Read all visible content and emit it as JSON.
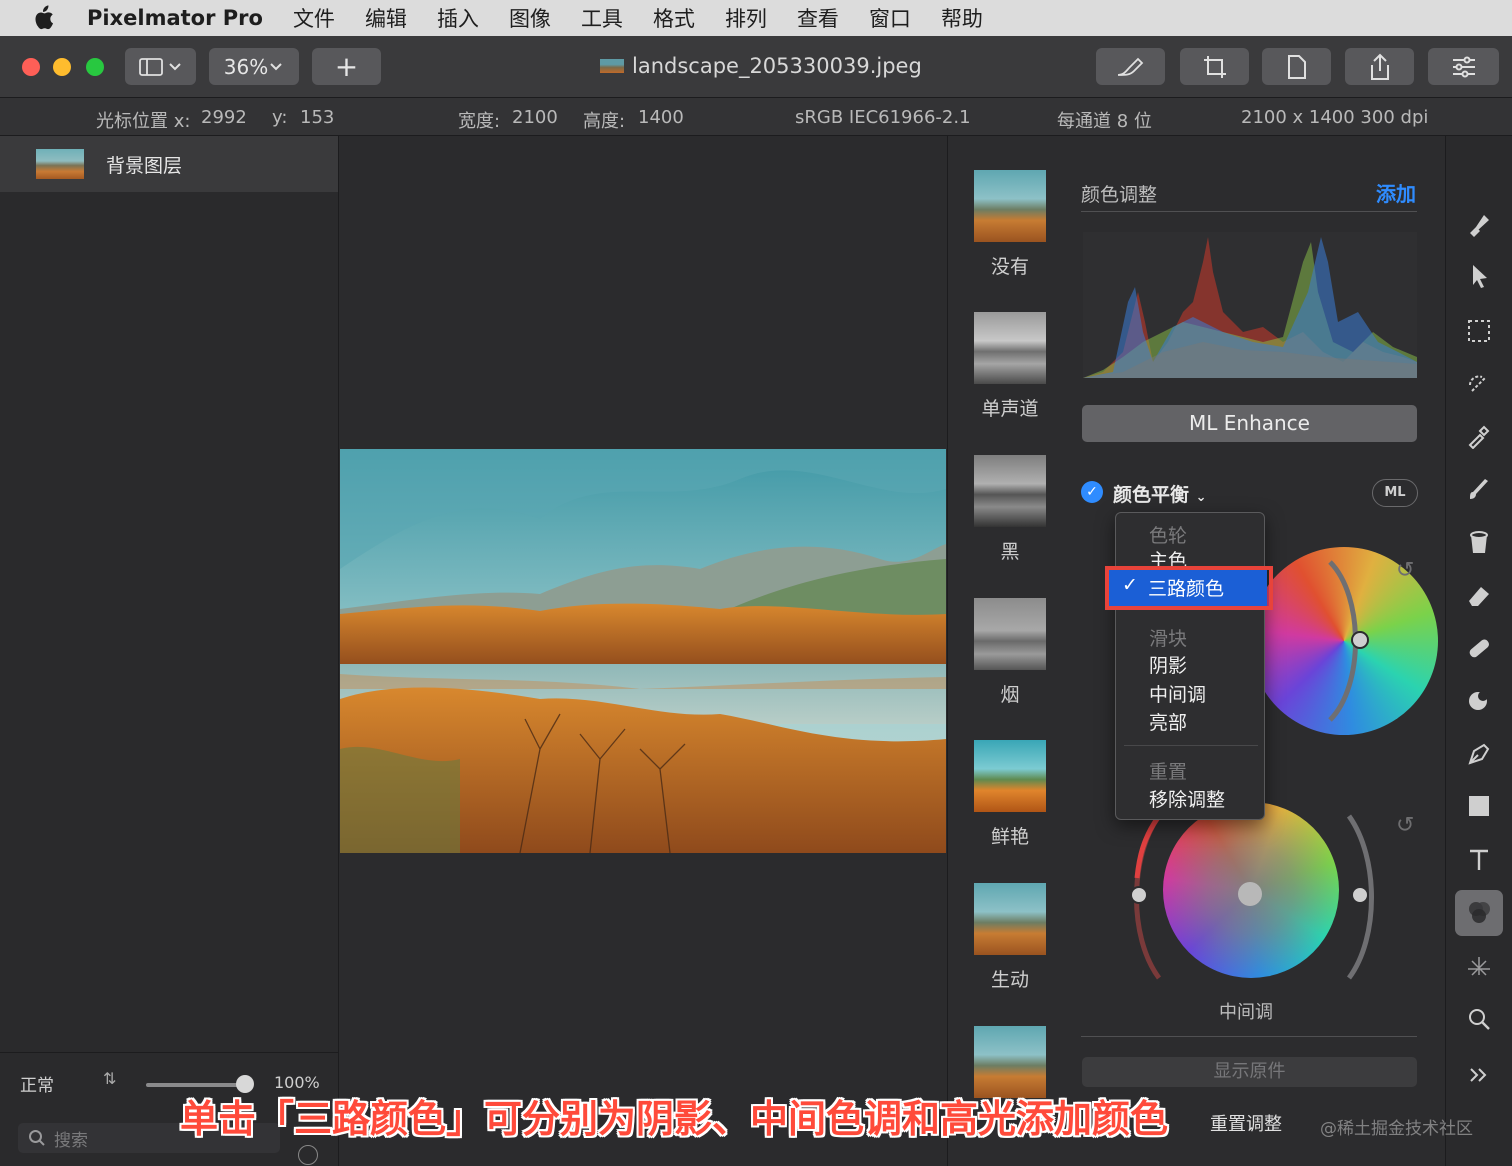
{
  "menubar": {
    "app_name": "Pixelmator Pro",
    "items": [
      "文件",
      "编辑",
      "插入",
      "图像",
      "工具",
      "格式",
      "排列",
      "查看",
      "窗口",
      "帮助"
    ]
  },
  "toolbar": {
    "zoom": "36%",
    "add_label": "+",
    "document_title": "landscape_205330039.jpeg"
  },
  "infobar": {
    "cursor_label": "光标位置 x:",
    "cursor_x": "2992",
    "cursor_y_label": "y:",
    "cursor_y": "153",
    "width_label": "宽度:",
    "width": "2100",
    "height_label": "高度:",
    "height": "1400",
    "color_profile": "sRGB IEC61966-2.1",
    "bit_depth": "每通道 8 位",
    "dimensions": "2100 x 1400 300 dpi"
  },
  "layers": {
    "items": [
      {
        "name": "背景图层"
      }
    ],
    "blend_mode": "正常",
    "opacity": "100%",
    "opacity_fraction": 1.0,
    "search_placeholder": "搜索"
  },
  "presets": [
    {
      "label": "没有",
      "style": "color"
    },
    {
      "label": "单声道",
      "style": "mono"
    },
    {
      "label": "黑",
      "style": "black"
    },
    {
      "label": "烟",
      "style": "smoke"
    },
    {
      "label": "鲜艳",
      "style": "vivid"
    },
    {
      "label": "生动",
      "style": "color"
    }
  ],
  "adjustments": {
    "title": "颜色调整",
    "add_label": "添加",
    "ml_enhance": "ML Enhance",
    "color_balance": "颜色平衡",
    "ml_badge": "ML",
    "midtones_label": "中间调",
    "show_original": "显示原件",
    "reset_adjustments": "重置调整"
  },
  "dropdown": {
    "header_wheels": "色轮",
    "primary": "主色",
    "three_way": "三路颜色",
    "header_sliders": "滑块",
    "shadows": "阴影",
    "midtones": "中间调",
    "highlights": "亮部",
    "reset": "重置",
    "remove": "移除调整"
  },
  "overlay": {
    "caption": "单击「三路颜色」可分别为阴影、中间色调和高光添加颜色",
    "watermark": "@稀土掘金技术社区"
  },
  "colors": {
    "accent": "#2f8cff",
    "selection": "#1b5fd6",
    "highlight_box": "#e8433a",
    "caption": "#ff4a3a"
  }
}
